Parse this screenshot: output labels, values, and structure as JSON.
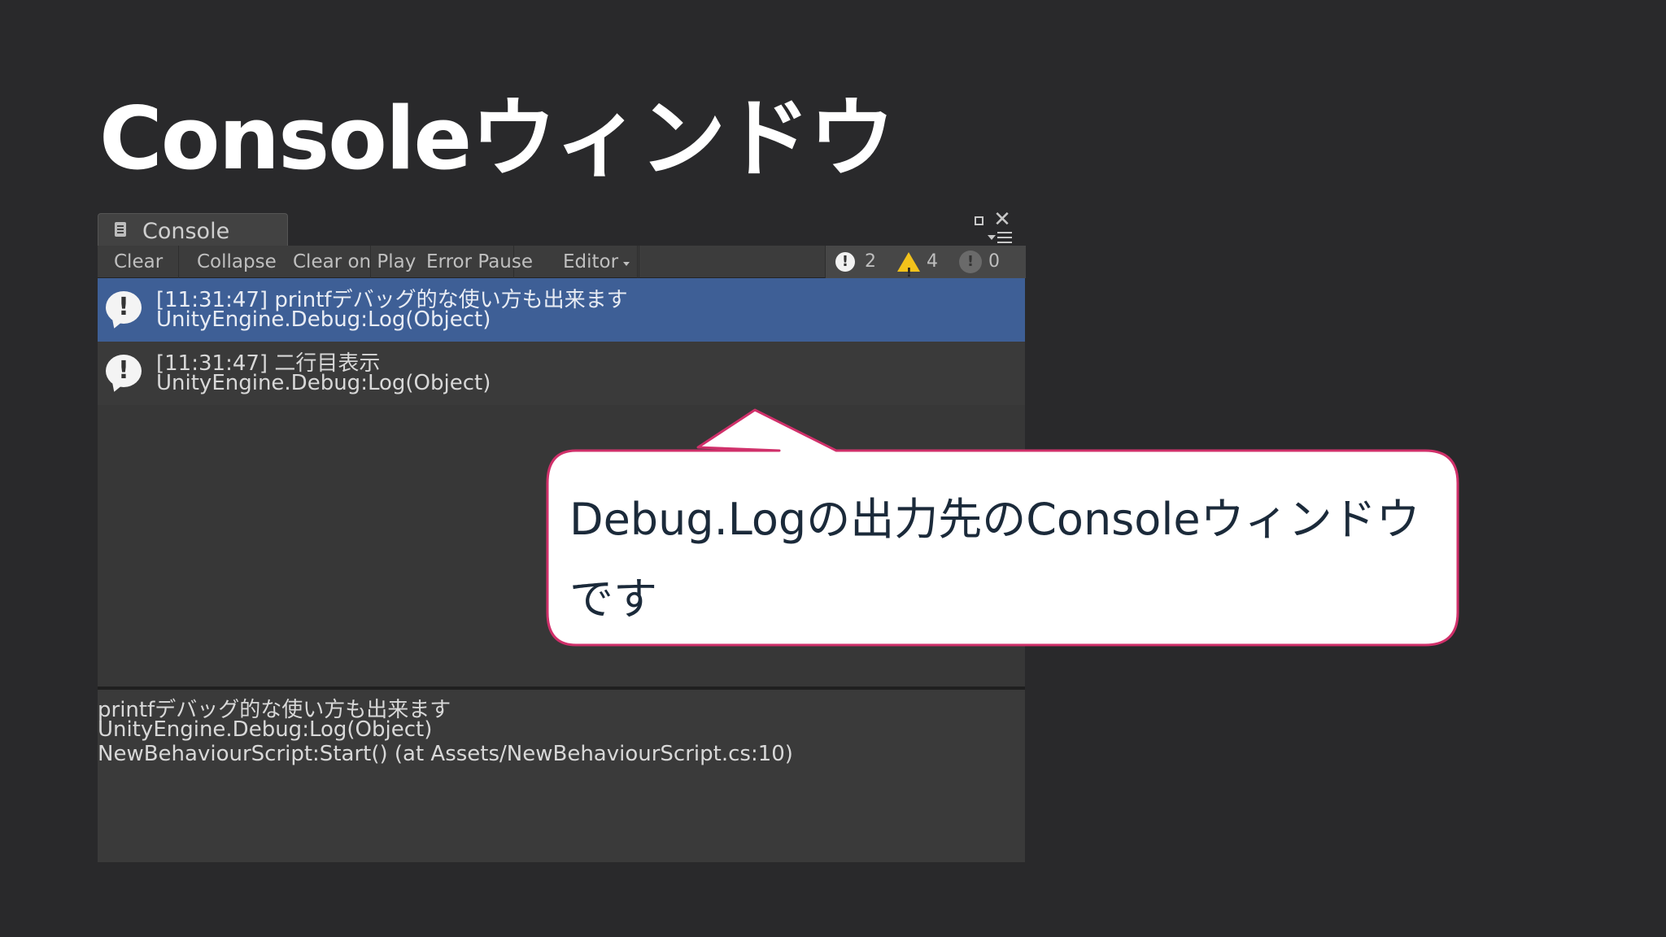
{
  "slide": {
    "title": "Consoleウィンドウ"
  },
  "window": {
    "tab_label": "Console",
    "close_glyph": "✕"
  },
  "toolbar": {
    "clear": "Clear",
    "collapse": "Collapse",
    "clear_on_play": "Clear on Play",
    "error_pause": "Error Pause",
    "editor": "Editor",
    "log_count": "2",
    "warning_count": "4",
    "error_count": "0",
    "log_icon_glyph": "!",
    "error_icon_glyph": "!"
  },
  "logs": [
    {
      "line1": "[11:31:47] printfデバッグ的な使い方も出来ます",
      "line2": "UnityEngine.Debug:Log(Object)",
      "selected": true,
      "icon": "info-icon"
    },
    {
      "line1": "[11:31:47] 二行目表示",
      "line2": "UnityEngine.Debug:Log(Object)",
      "selected": false,
      "icon": "info-icon"
    }
  ],
  "detail": {
    "line1": "printfデバッグ的な使い方も出来ます",
    "line2": "UnityEngine.Debug:Log(Object)",
    "line3": "NewBehaviourScript:Start() (at Assets/NewBehaviourScript.cs:10)"
  },
  "callout": {
    "text": "Debug.Logの出力先のConsoleウィンドウです"
  },
  "colors": {
    "background": "#29292b",
    "selected_row": "#3e5f96",
    "callout_border": "#d0306a",
    "warning": "#f2c21b"
  }
}
